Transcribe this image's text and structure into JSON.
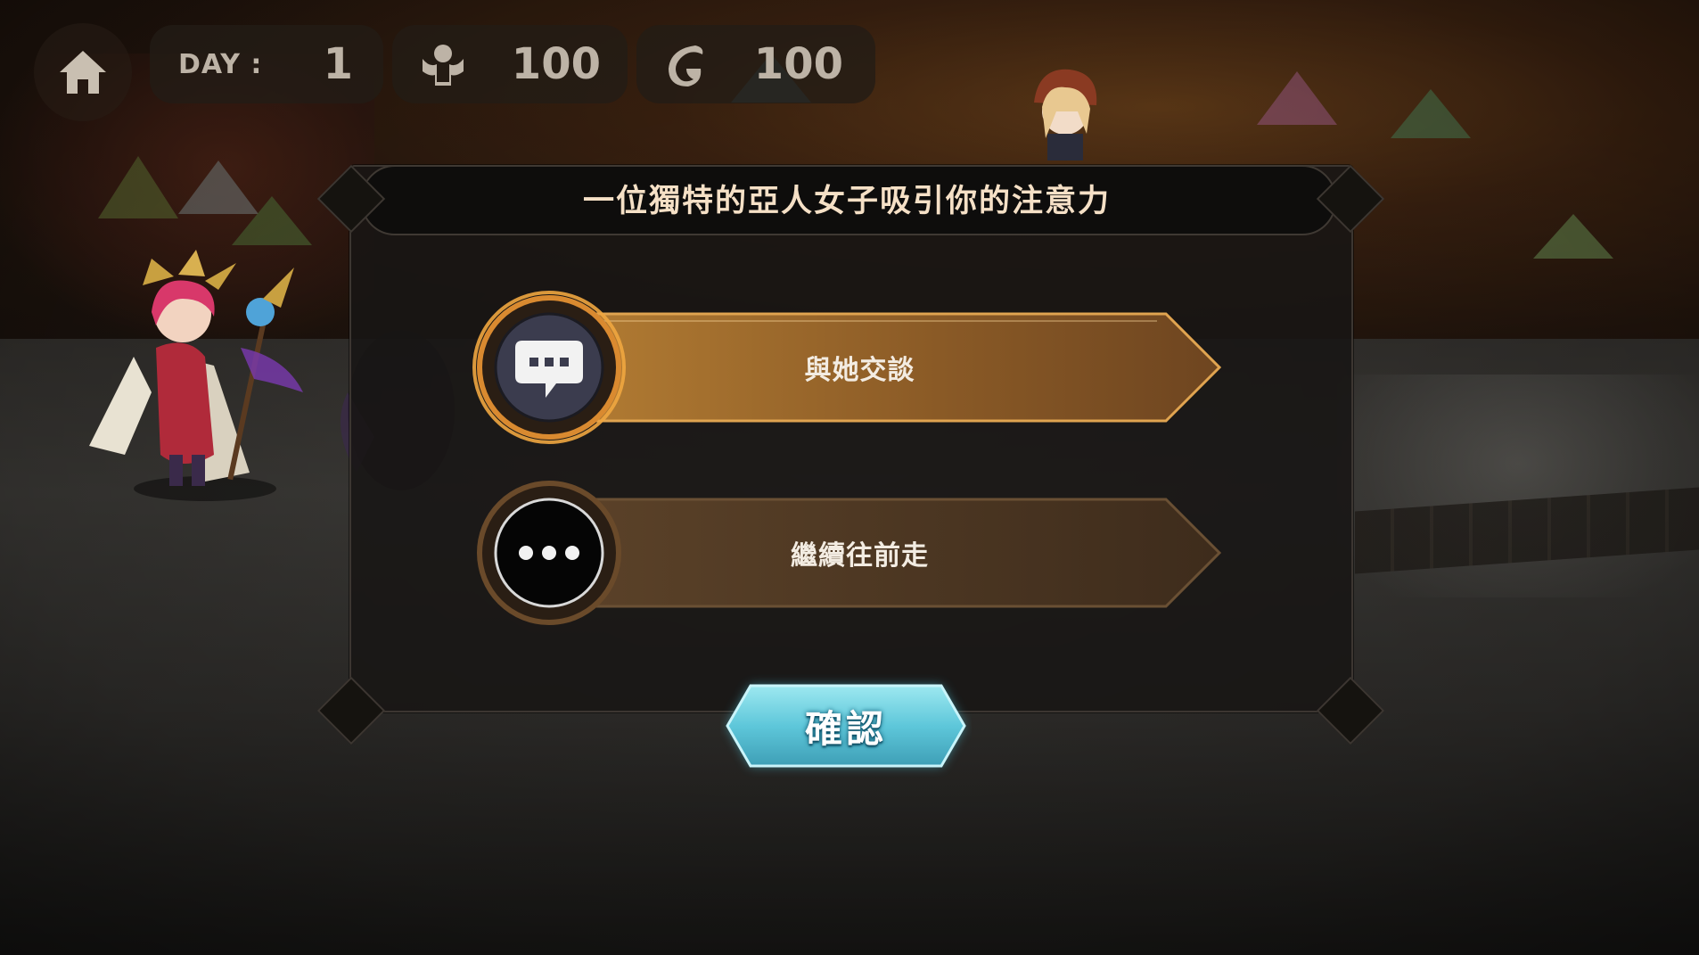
{
  "hud": {
    "day_label": "DAY :",
    "day_value": "1",
    "population_value": "100",
    "currency_value": "100",
    "icons": [
      "home-icon",
      "population-icon",
      "currency-icon"
    ]
  },
  "dialog": {
    "title": "一位獨特的亞人女子吸引你的注意力",
    "options": [
      {
        "label": "與她交談",
        "icon": "speech-bubble-icon",
        "selected": true
      },
      {
        "label": "繼續往前走",
        "icon": "ellipsis-icon",
        "selected": false
      }
    ],
    "confirm_label": "確認"
  },
  "colors": {
    "accent_gold": "#f0a640",
    "confirm_cyan": "#6fd6e6",
    "title_text": "#f5e0c6"
  }
}
